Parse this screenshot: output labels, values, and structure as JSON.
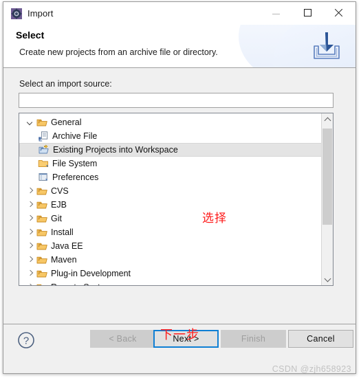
{
  "window": {
    "title": "Import",
    "app_icon": "eclipse-import-icon",
    "controls": {
      "minimize": "minimize-icon",
      "maximize": "maximize-icon",
      "close": "close-icon"
    }
  },
  "header": {
    "title": "Select",
    "description": "Create new projects from an archive file or directory.",
    "banner_icon": "import-tray-arrow-icon"
  },
  "body": {
    "source_label": "Select an import source:",
    "filter": {
      "value": "",
      "placeholder": ""
    },
    "tree": [
      {
        "label": "General",
        "icon": "folder-open-icon",
        "twisty": "expanded",
        "level": 0,
        "selected": false
      },
      {
        "label": "Archive File",
        "icon": "archive-file-icon",
        "twisty": "none",
        "level": 1,
        "selected": false
      },
      {
        "label": "Existing Projects into Workspace",
        "icon": "import-project-icon",
        "twisty": "none",
        "level": 1,
        "selected": true
      },
      {
        "label": "File System",
        "icon": "folder-icon",
        "twisty": "none",
        "level": 1,
        "selected": false
      },
      {
        "label": "Preferences",
        "icon": "preferences-icon",
        "twisty": "none",
        "level": 1,
        "selected": false
      },
      {
        "label": "CVS",
        "icon": "folder-open-icon",
        "twisty": "collapsed",
        "level": 0,
        "selected": false
      },
      {
        "label": "EJB",
        "icon": "folder-open-icon",
        "twisty": "collapsed",
        "level": 0,
        "selected": false
      },
      {
        "label": "Git",
        "icon": "folder-open-icon",
        "twisty": "collapsed",
        "level": 0,
        "selected": false
      },
      {
        "label": "Install",
        "icon": "folder-open-icon",
        "twisty": "collapsed",
        "level": 0,
        "selected": false
      },
      {
        "label": "Java EE",
        "icon": "folder-open-icon",
        "twisty": "collapsed",
        "level": 0,
        "selected": false
      },
      {
        "label": "Maven",
        "icon": "folder-open-icon",
        "twisty": "collapsed",
        "level": 0,
        "selected": false
      },
      {
        "label": "Plug-in Development",
        "icon": "folder-open-icon",
        "twisty": "collapsed",
        "level": 0,
        "selected": false
      },
      {
        "label": "Remote Systems",
        "icon": "folder-open-icon",
        "twisty": "collapsed",
        "level": 0,
        "selected": false
      }
    ],
    "scrollbar": {
      "up_arrow": "chevron-up-icon",
      "down_arrow": "chevron-down-icon"
    }
  },
  "annotations": {
    "select_note": "选择",
    "next_note": "下一步",
    "color": "#fe1a1a"
  },
  "footer": {
    "help_icon": "help-question-icon",
    "buttons": [
      {
        "label": "< Back",
        "state": "disabled"
      },
      {
        "label": "Next >",
        "state": "focused"
      },
      {
        "label": "Finish",
        "state": "disabled"
      },
      {
        "label": "Cancel",
        "state": "enabled"
      }
    ],
    "watermark": "CSDN @zjh658923"
  }
}
